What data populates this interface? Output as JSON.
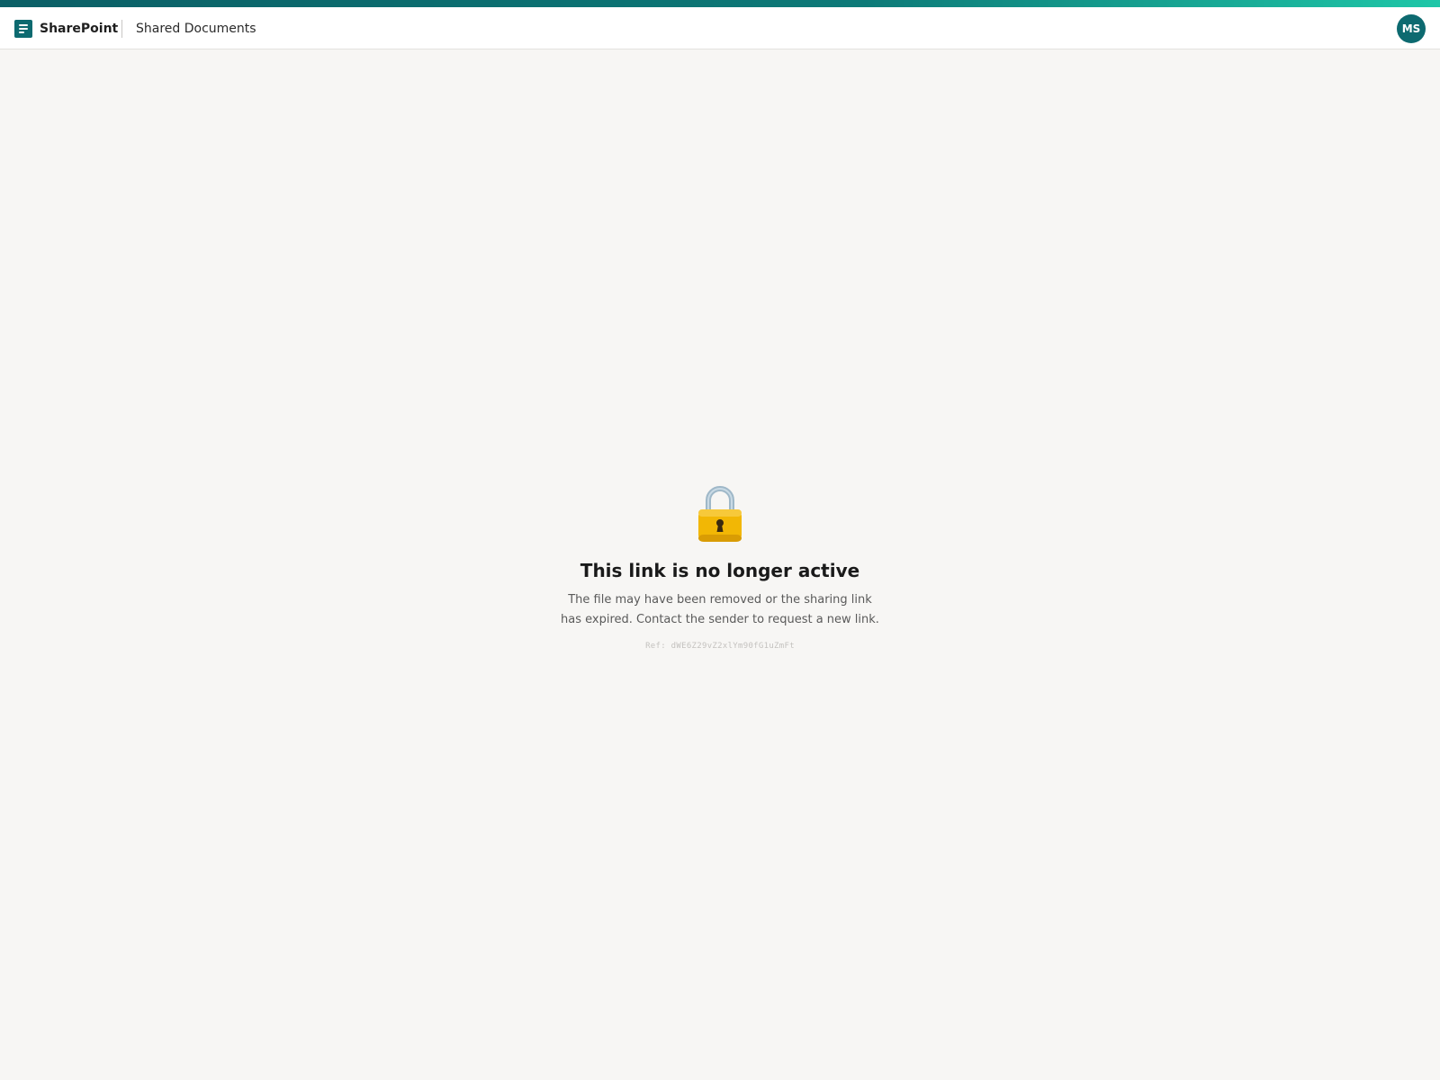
{
  "header": {
    "app_name": "SharePoint",
    "site_name": "Shared Documents",
    "avatar_initials": "MS"
  },
  "error": {
    "icon": "lock-icon",
    "title": "This link is no longer active",
    "message": "The file may have been removed or the sharing link has expired. Contact the sender to request a new link.",
    "reference": "Ref: dWE6Z29vZ2xlYm90fG1uZmFt"
  },
  "colors": {
    "brand": "#0d6a70",
    "accent_gradient_end": "#1fc7a8",
    "background": "#f7f6f4",
    "lock_body": "#f2b705",
    "lock_shackle": "#9fb8c8"
  }
}
